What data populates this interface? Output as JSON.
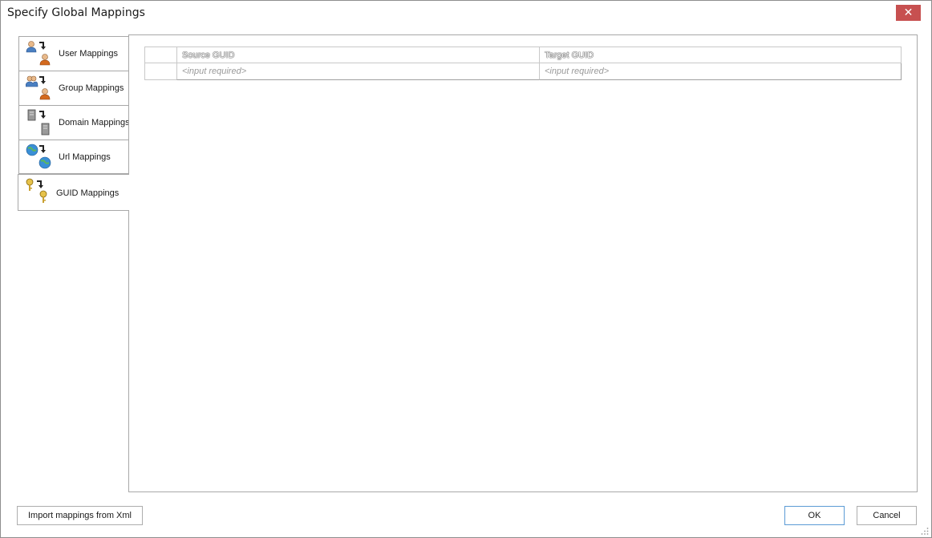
{
  "window": {
    "title": "Specify Global Mappings",
    "close_label": "✕"
  },
  "sidebar": {
    "items": [
      {
        "label": "User Mappings",
        "icon": "user-mapping-icon"
      },
      {
        "label": "Group Mappings",
        "icon": "group-mapping-icon"
      },
      {
        "label": "Domain Mappings",
        "icon": "domain-mapping-icon"
      },
      {
        "label": "Url Mappings",
        "icon": "url-mapping-icon"
      },
      {
        "label": "GUID Mappings",
        "icon": "guid-mapping-icon"
      }
    ],
    "active_index": 4
  },
  "grid": {
    "columns": [
      "Source GUID",
      "Target GUID"
    ],
    "new_row": {
      "source_placeholder": "<input required>",
      "target_placeholder": "<input required>"
    }
  },
  "footer": {
    "import_label": "Import mappings from Xml",
    "ok_label": "OK",
    "cancel_label": "Cancel"
  },
  "colors": {
    "close_button": "#c75050",
    "ok_border": "#5b9bd5",
    "border": "#a8a8a8"
  }
}
